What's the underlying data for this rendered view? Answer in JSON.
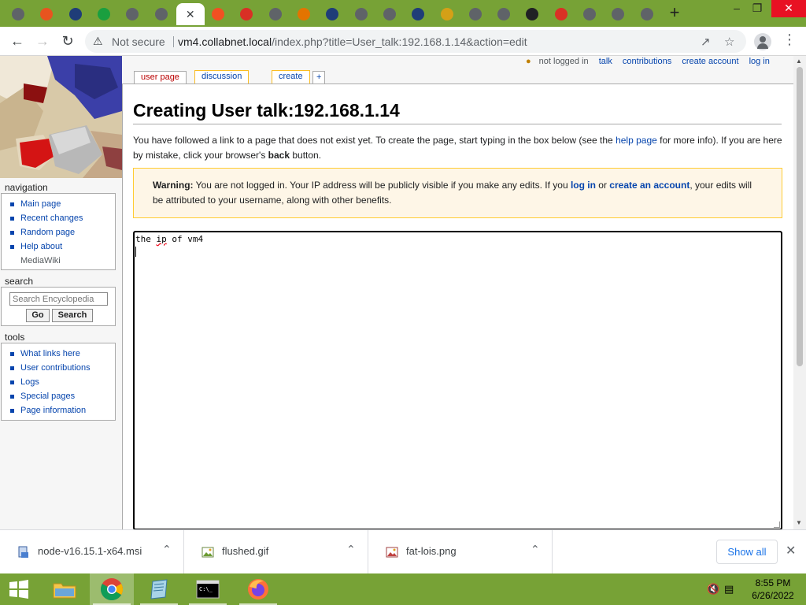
{
  "browser": {
    "tabs": [
      {
        "icon": "globe-icon",
        "color": "#5f6368"
      },
      {
        "icon": "red-app-icon",
        "color": "#e8541f"
      },
      {
        "icon": "sqlite-icon",
        "color": "#1f3d78"
      },
      {
        "icon": "n-green-icon",
        "color": "#1a9f3f"
      },
      {
        "icon": "download-icon",
        "color": "#5f6368"
      },
      {
        "icon": "globe-icon",
        "color": "#5f6368"
      },
      {
        "icon": "active-tab-globe-icon",
        "color": "#5f6368"
      },
      {
        "icon": "microsoft-icon",
        "color": "#f25022"
      },
      {
        "icon": "red-circle-icon",
        "color": "#d93025"
      },
      {
        "icon": "globe-icon",
        "color": "#5f6368"
      },
      {
        "icon": "orange-box-icon",
        "color": "#e37400"
      },
      {
        "icon": "sqlite-icon",
        "color": "#1f3d78"
      },
      {
        "icon": "chrome-icon",
        "color": "#5f6368"
      },
      {
        "icon": "diamond-icon",
        "color": "#5f6368"
      },
      {
        "icon": "sqlite-icon",
        "color": "#1f3d78"
      },
      {
        "icon": "bookmark-yellow-icon",
        "color": "#d4a017"
      },
      {
        "icon": "gear-icon",
        "color": "#5f6368"
      },
      {
        "icon": "globe-icon",
        "color": "#5f6368"
      },
      {
        "icon": "wikipedia-icon",
        "color": "#202124"
      },
      {
        "icon": "red-circle-icon",
        "color": "#d93025"
      },
      {
        "icon": "globe-icon",
        "color": "#5f6368"
      },
      {
        "icon": "globe-icon",
        "color": "#5f6368"
      },
      {
        "icon": "gear-icon",
        "color": "#5f6368"
      }
    ],
    "tabstrip_color": "#77a236",
    "security_label": "Not secure",
    "url_host": "vm4.collabnet.local",
    "url_path": "/index.php?title=User_talk:192.168.1.14&action=edit"
  },
  "personal": {
    "not_logged_in": "not logged in",
    "talk": "talk",
    "contributions": "contributions",
    "create_account": "create account",
    "log_in": "log in"
  },
  "content_tabs": {
    "user_page": "user page",
    "discussion": "discussion",
    "create": "create",
    "plus": "+"
  },
  "sidebar": {
    "navigation_title": "navigation",
    "navigation": [
      "Main page",
      "Recent changes",
      "Random page",
      "Help about",
      "MediaWiki"
    ],
    "search_title": "search",
    "search_placeholder": "Search Encyclopedia",
    "go": "Go",
    "search": "Search",
    "tools_title": "tools",
    "tools": [
      "What links here",
      "User contributions",
      "Logs",
      "Special pages",
      "Page information"
    ]
  },
  "page": {
    "title": "Creating User talk:192.168.1.14",
    "intro_1": "You have followed a link to a page that does not exist yet. To create the page, start typing in the box below (see the ",
    "intro_link": "help page",
    "intro_2": " for more info). If you are here by mistake, click your browser's ",
    "intro_back": "back",
    "intro_3": " button.",
    "warning_label": "Warning:",
    "warning_1": " You are not logged in. Your IP address will be publicly visible if you make any edits. If you ",
    "warning_login": "log in",
    "warning_or": " or ",
    "warning_create": "create an account",
    "warning_2": ", your edits will be attributed to your username, along with other benefits.",
    "editor_word1": "the ",
    "editor_word2": "ip",
    "editor_word3": " of vm4"
  },
  "downloads": {
    "items": [
      {
        "name": "node-v16.15.1-x64.msi",
        "icon": "msi-installer-icon"
      },
      {
        "name": "flushed.gif",
        "icon": "image-file-icon"
      },
      {
        "name": "fat-lois.png",
        "icon": "image-file-icon"
      }
    ],
    "show_all": "Show all"
  },
  "taskbar": {
    "time": "8:55 PM",
    "date": "6/26/2022"
  }
}
